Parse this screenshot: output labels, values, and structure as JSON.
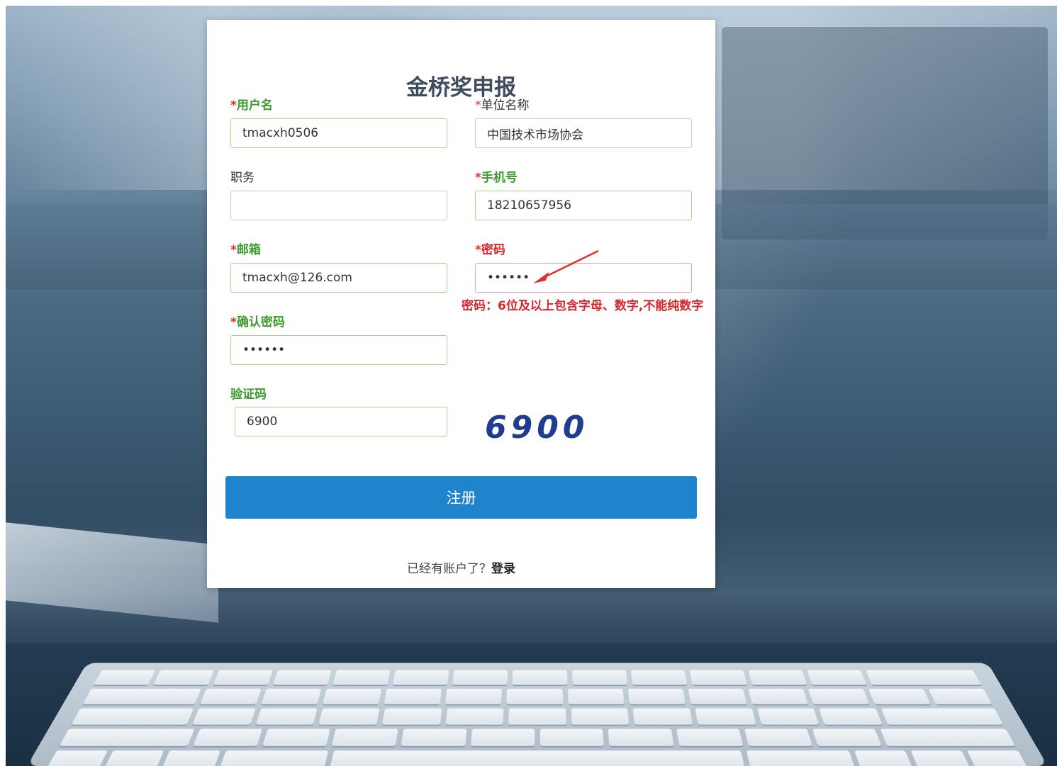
{
  "form": {
    "title": "金桥奖申报",
    "username": {
      "required_mark": "*",
      "label": "用户名",
      "value": "tmacxh0506"
    },
    "org_name": {
      "required_mark": "*",
      "label": "单位名称",
      "value": "中国技术市场协会"
    },
    "position": {
      "label": "职务",
      "value": ""
    },
    "phone": {
      "required_mark": "*",
      "label": "手机号",
      "value": "18210657956"
    },
    "email": {
      "required_mark": "*",
      "label": "邮箱",
      "value": "tmacxh@126.com"
    },
    "password": {
      "required_mark": "*",
      "label": "密码",
      "value": "••••••",
      "hint": "密码：6位及以上包含字母、数字,不能纯数字"
    },
    "confirm_password": {
      "required_mark": "*",
      "label": "确认密码",
      "value": "••••••"
    },
    "captcha": {
      "label": "验证码",
      "value": "6900",
      "image_text": "6900"
    },
    "submit_label": "注册",
    "footer_text": "已经有账户了？",
    "login_link": "登录"
  },
  "colors": {
    "label_green": "#3c9a2e",
    "required_red": "#e0302a",
    "error_red": "#d8262c",
    "button_blue": "#1f84cc",
    "captcha_blue": "#1e3d8f"
  },
  "icons": [
    "annotation-arrow-icon"
  ]
}
